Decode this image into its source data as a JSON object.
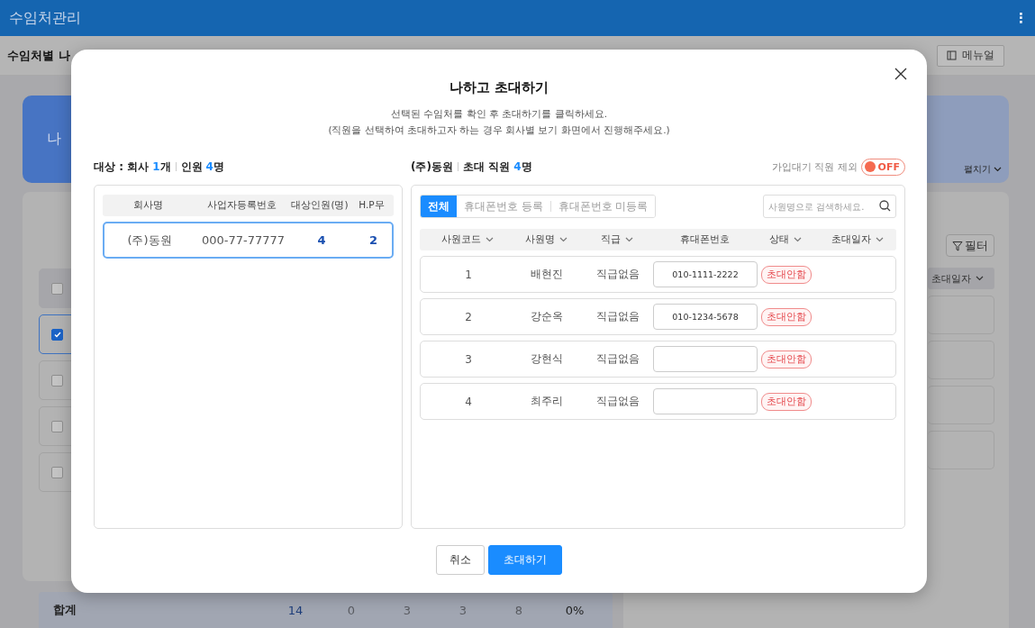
{
  "app_bar": {
    "title": "수임처관리",
    "menu_icon": "⋮"
  },
  "page": {
    "title": "수임처별 나",
    "manual_button": "메뉴얼",
    "banner_title": "나",
    "expand_label": "펼치기",
    "filter_button": "필터",
    "column_header": "초대일자",
    "rows": [
      {
        "kind": "header",
        "checked": false
      },
      {
        "kind": "row",
        "checked": true
      },
      {
        "kind": "row",
        "checked": false
      },
      {
        "kind": "row",
        "checked": false
      },
      {
        "kind": "row",
        "checked": false
      }
    ],
    "total": {
      "label": "합계",
      "values": [
        "14",
        "0",
        "3",
        "3",
        "8",
        "0%"
      ]
    }
  },
  "modal": {
    "title": "나하고 초대하기",
    "description": [
      "선택된 수임처를 확인 후 초대하기를 클릭하세요.",
      "(직원을 선택하여 초대하고자 하는 경우 회사별 보기 화면에서 진행해주세요.)"
    ],
    "summary": {
      "label": "대상 : 회사",
      "company_count": "1",
      "company_unit": "개",
      "people_label": "인원",
      "people_count": "4",
      "people_unit": "명"
    },
    "companies": {
      "columns": [
        "회사명",
        "사업자등록번호",
        "대상인원(명)",
        "H.P무"
      ],
      "rows": [
        {
          "cells": [
            "(주)동원",
            "000-77-77777",
            "4",
            "2"
          ],
          "selected": true
        }
      ]
    },
    "employees": {
      "company": "(주)동원",
      "label": "초대 직원",
      "count": "4",
      "count_unit": "명",
      "exclude_toggle": {
        "label": "가입대기 직원 제외",
        "on": false,
        "text": "OFF"
      },
      "tabs": [
        {
          "label": "전체",
          "selected": true
        },
        {
          "label": "휴대폰번호 등록",
          "selected": false
        },
        {
          "label": "휴대폰번호 미등록",
          "selected": false
        }
      ],
      "search": {
        "placeholder": "사원명으로 검색하세요."
      },
      "columns": [
        {
          "label": "사원코드",
          "sortable": true
        },
        {
          "label": "사원명",
          "sortable": true
        },
        {
          "label": "직급",
          "sortable": true
        },
        {
          "label": "휴대폰번호",
          "sortable": false
        },
        {
          "label": "상태",
          "sortable": true
        },
        {
          "label": "초대일자",
          "sortable": true
        }
      ],
      "rows": [
        {
          "code": "1",
          "name": "배현진",
          "rank": "직급없음",
          "phone": "010-1111-2222",
          "status": "초대안함"
        },
        {
          "code": "2",
          "name": "강순옥",
          "rank": "직급없음",
          "phone": "010-1234-5678",
          "status": "초대안함"
        },
        {
          "code": "3",
          "name": "강현식",
          "rank": "직급없음",
          "status": "초대안함"
        },
        {
          "code": "4",
          "name": "최주리",
          "rank": "직급없음",
          "status": "초대안함"
        }
      ]
    },
    "buttons": [
      {
        "label": "취소",
        "kind": "secondary"
      },
      {
        "label": "초대하기",
        "kind": "primary"
      }
    ]
  }
}
